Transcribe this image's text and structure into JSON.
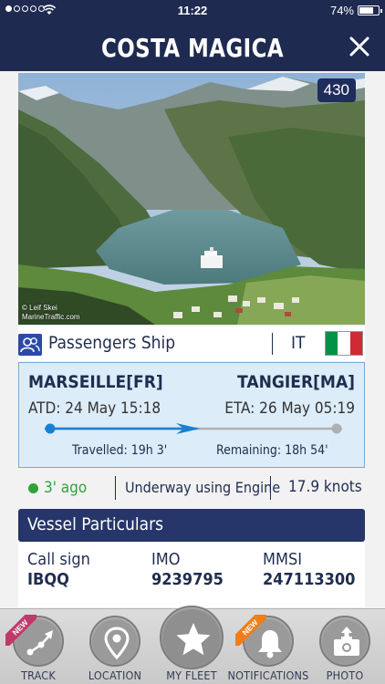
{
  "status_bar": {
    "time": "11:22",
    "battery": "74%",
    "battery_level": 0.74,
    "signal_bars_filled": 1,
    "signal_bars_total": 5
  },
  "header": {
    "title": "COSTA MAGICA",
    "close_icon": "close-icon"
  },
  "photo": {
    "badge": "430",
    "credit_line1": "© Leif Skei",
    "credit_line2": "MarineTraffic.com"
  },
  "vessel": {
    "type": "Passengers Ship",
    "type_icon": "passengers-icon",
    "country": "IT",
    "flag_colors": [
      "#009246",
      "#ffffff",
      "#ce2b37"
    ]
  },
  "voyage": {
    "origin": "MARSEILLE[FR]",
    "destination": "TANGIER[MA]",
    "atd": "ATD: 24 May 15:18",
    "eta": "ETA: 26 May 05:19",
    "progress": 0.51,
    "travelled": "Travelled: 19h 3'",
    "remaining": "Remaining: 18h 54'",
    "colors": {
      "done": "#1a7fd1",
      "left": "#b0b0b0",
      "box_bg": "#dcecf8"
    }
  },
  "status": {
    "last_seen": "3' ago",
    "nav_status": "Underway using Engine",
    "speed": "17.9 knots",
    "status_color": "#2fa33b"
  },
  "particulars": {
    "title": "Vessel Particulars",
    "fields": [
      {
        "label": "Call sign",
        "value": "IBQQ"
      },
      {
        "label": "IMO",
        "value": "9239795"
      },
      {
        "label": "MMSI",
        "value": "247113300"
      }
    ]
  },
  "tabs": [
    {
      "label": "TRACK",
      "icon": "track-icon",
      "badge": "NEW"
    },
    {
      "label": "LOCATION",
      "icon": "location-pin-icon"
    },
    {
      "label": "MY FLEET",
      "icon": "star-icon"
    },
    {
      "label": "NOTIFICATIONS",
      "icon": "bell-icon",
      "badge": "NEW"
    },
    {
      "label": "PHOTO",
      "icon": "camera-upload-icon"
    }
  ],
  "colors": {
    "navy": "#1e2a50",
    "section_header": "#26356a",
    "ribbon_track": "#c0396b",
    "ribbon_notifications": "#ef7d1a"
  }
}
